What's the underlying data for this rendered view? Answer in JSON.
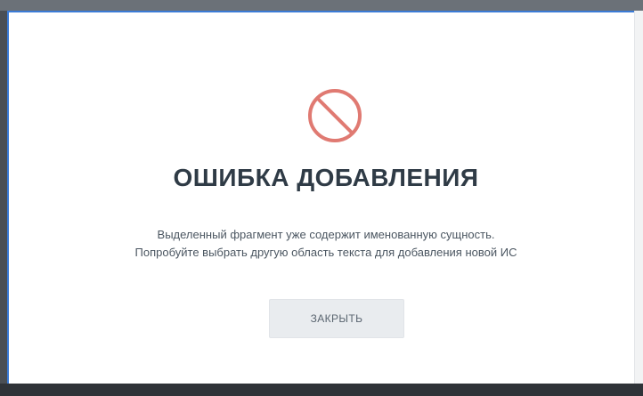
{
  "dialog": {
    "icon": "prohibited-icon",
    "title": "ОШИБКА ДОБАВЛЕНИЯ",
    "message_line1": "Выделенный фрагмент уже содержит именованную сущность.",
    "message_line2": "Попробуйте выбрать другую область текста для добавления новой ИС",
    "close_label": "ЗАКРЫТЬ"
  },
  "colors": {
    "icon": "#e07a72",
    "title": "#2f3b46",
    "text": "#4b5661",
    "button_bg": "#e9ecef",
    "accent_border": "#3b7bd6"
  }
}
